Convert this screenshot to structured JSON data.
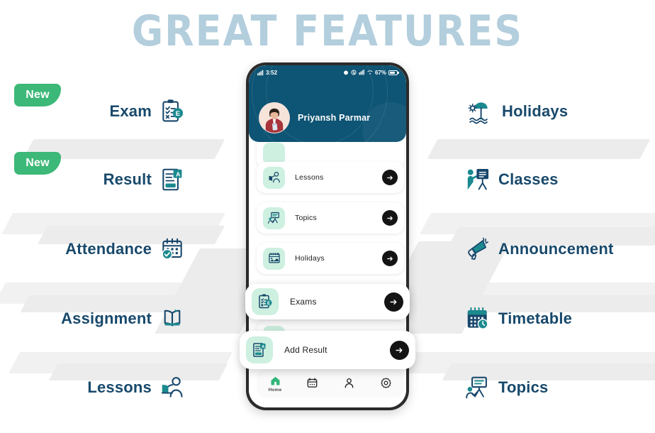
{
  "page": {
    "title": "GREAT FEATURES",
    "title_color": "#b3cedd",
    "background": "#ffffff"
  },
  "badges": {
    "new_label": "New",
    "new_color": "#3cb878"
  },
  "theme": {
    "label_color": "#18496b",
    "icon_teal": "#1b8a8f",
    "icon_navy": "#17466b",
    "header_blue": "#0e5474",
    "mint": "#cdf0e0",
    "arrow_black": "#141414",
    "ribbon_gray": "#ececec"
  },
  "features": {
    "left": [
      {
        "label": "Exam",
        "icon": "exam-clipboard-icon",
        "badge": "New"
      },
      {
        "label": "Result",
        "icon": "result-document-icon",
        "badge": "New"
      },
      {
        "label": "Attendance",
        "icon": "attendance-calendar-check-icon",
        "badge": ""
      },
      {
        "label": "Assignment",
        "icon": "assignment-book-icon",
        "badge": ""
      },
      {
        "label": "Lessons",
        "icon": "lessons-person-book-icon",
        "badge": ""
      }
    ],
    "right": [
      {
        "label": "Holidays",
        "icon": "holidays-beach-umbrella-icon"
      },
      {
        "label": "Classes",
        "icon": "classes-teacher-board-icon"
      },
      {
        "label": "Announcement",
        "icon": "announcement-megaphone-icon"
      },
      {
        "label": "Timetable",
        "icon": "timetable-calendar-clock-icon"
      },
      {
        "label": "Topics",
        "icon": "topics-presentation-icon"
      }
    ]
  },
  "phone": {
    "status_bar": {
      "time": "3:52",
      "battery_percent": "67%",
      "icons": [
        "sim-signal-icon",
        "alarm-icon",
        "bluetooth-icon",
        "wifi-data-icon",
        "signal-bars-icon"
      ]
    },
    "header": {
      "user_name": "Priyansh Parmar",
      "avatar": "user-avatar"
    },
    "list_items": [
      {
        "label": "Lessons",
        "icon": "lessons-person-book-icon",
        "arrow": "arrow-right-icon"
      },
      {
        "label": "Topics",
        "icon": "topics-presentation-icon",
        "arrow": "arrow-right-icon"
      },
      {
        "label": "Holidays",
        "icon": "holidays-card-icon",
        "arrow": "arrow-right-icon"
      }
    ],
    "floating_cards": [
      {
        "label": "Exams",
        "icon": "exam-clipboard-icon",
        "arrow": "arrow-right-icon"
      },
      {
        "label": "Add Result",
        "icon": "result-document-icon",
        "arrow": "arrow-right-icon"
      }
    ],
    "bottom_nav": [
      {
        "label": "Home",
        "icon": "home-icon",
        "active": true
      },
      {
        "label": "",
        "icon": "calendar-icon",
        "active": false
      },
      {
        "label": "",
        "icon": "person-icon",
        "active": false
      },
      {
        "label": "",
        "icon": "gear-icon",
        "active": false
      }
    ]
  }
}
